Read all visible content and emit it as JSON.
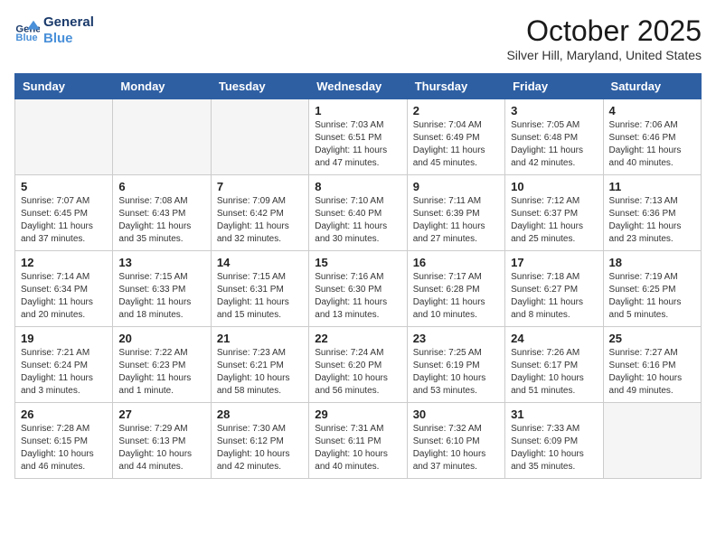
{
  "header": {
    "logo_line1": "General",
    "logo_line2": "Blue",
    "month_title": "October 2025",
    "location": "Silver Hill, Maryland, United States"
  },
  "weekdays": [
    "Sunday",
    "Monday",
    "Tuesday",
    "Wednesday",
    "Thursday",
    "Friday",
    "Saturday"
  ],
  "weeks": [
    [
      {
        "day": "",
        "info": ""
      },
      {
        "day": "",
        "info": ""
      },
      {
        "day": "",
        "info": ""
      },
      {
        "day": "1",
        "info": "Sunrise: 7:03 AM\nSunset: 6:51 PM\nDaylight: 11 hours\nand 47 minutes."
      },
      {
        "day": "2",
        "info": "Sunrise: 7:04 AM\nSunset: 6:49 PM\nDaylight: 11 hours\nand 45 minutes."
      },
      {
        "day": "3",
        "info": "Sunrise: 7:05 AM\nSunset: 6:48 PM\nDaylight: 11 hours\nand 42 minutes."
      },
      {
        "day": "4",
        "info": "Sunrise: 7:06 AM\nSunset: 6:46 PM\nDaylight: 11 hours\nand 40 minutes."
      }
    ],
    [
      {
        "day": "5",
        "info": "Sunrise: 7:07 AM\nSunset: 6:45 PM\nDaylight: 11 hours\nand 37 minutes."
      },
      {
        "day": "6",
        "info": "Sunrise: 7:08 AM\nSunset: 6:43 PM\nDaylight: 11 hours\nand 35 minutes."
      },
      {
        "day": "7",
        "info": "Sunrise: 7:09 AM\nSunset: 6:42 PM\nDaylight: 11 hours\nand 32 minutes."
      },
      {
        "day": "8",
        "info": "Sunrise: 7:10 AM\nSunset: 6:40 PM\nDaylight: 11 hours\nand 30 minutes."
      },
      {
        "day": "9",
        "info": "Sunrise: 7:11 AM\nSunset: 6:39 PM\nDaylight: 11 hours\nand 27 minutes."
      },
      {
        "day": "10",
        "info": "Sunrise: 7:12 AM\nSunset: 6:37 PM\nDaylight: 11 hours\nand 25 minutes."
      },
      {
        "day": "11",
        "info": "Sunrise: 7:13 AM\nSunset: 6:36 PM\nDaylight: 11 hours\nand 23 minutes."
      }
    ],
    [
      {
        "day": "12",
        "info": "Sunrise: 7:14 AM\nSunset: 6:34 PM\nDaylight: 11 hours\nand 20 minutes."
      },
      {
        "day": "13",
        "info": "Sunrise: 7:15 AM\nSunset: 6:33 PM\nDaylight: 11 hours\nand 18 minutes."
      },
      {
        "day": "14",
        "info": "Sunrise: 7:15 AM\nSunset: 6:31 PM\nDaylight: 11 hours\nand 15 minutes."
      },
      {
        "day": "15",
        "info": "Sunrise: 7:16 AM\nSunset: 6:30 PM\nDaylight: 11 hours\nand 13 minutes."
      },
      {
        "day": "16",
        "info": "Sunrise: 7:17 AM\nSunset: 6:28 PM\nDaylight: 11 hours\nand 10 minutes."
      },
      {
        "day": "17",
        "info": "Sunrise: 7:18 AM\nSunset: 6:27 PM\nDaylight: 11 hours\nand 8 minutes."
      },
      {
        "day": "18",
        "info": "Sunrise: 7:19 AM\nSunset: 6:25 PM\nDaylight: 11 hours\nand 5 minutes."
      }
    ],
    [
      {
        "day": "19",
        "info": "Sunrise: 7:21 AM\nSunset: 6:24 PM\nDaylight: 11 hours\nand 3 minutes."
      },
      {
        "day": "20",
        "info": "Sunrise: 7:22 AM\nSunset: 6:23 PM\nDaylight: 11 hours\nand 1 minute."
      },
      {
        "day": "21",
        "info": "Sunrise: 7:23 AM\nSunset: 6:21 PM\nDaylight: 10 hours\nand 58 minutes."
      },
      {
        "day": "22",
        "info": "Sunrise: 7:24 AM\nSunset: 6:20 PM\nDaylight: 10 hours\nand 56 minutes."
      },
      {
        "day": "23",
        "info": "Sunrise: 7:25 AM\nSunset: 6:19 PM\nDaylight: 10 hours\nand 53 minutes."
      },
      {
        "day": "24",
        "info": "Sunrise: 7:26 AM\nSunset: 6:17 PM\nDaylight: 10 hours\nand 51 minutes."
      },
      {
        "day": "25",
        "info": "Sunrise: 7:27 AM\nSunset: 6:16 PM\nDaylight: 10 hours\nand 49 minutes."
      }
    ],
    [
      {
        "day": "26",
        "info": "Sunrise: 7:28 AM\nSunset: 6:15 PM\nDaylight: 10 hours\nand 46 minutes."
      },
      {
        "day": "27",
        "info": "Sunrise: 7:29 AM\nSunset: 6:13 PM\nDaylight: 10 hours\nand 44 minutes."
      },
      {
        "day": "28",
        "info": "Sunrise: 7:30 AM\nSunset: 6:12 PM\nDaylight: 10 hours\nand 42 minutes."
      },
      {
        "day": "29",
        "info": "Sunrise: 7:31 AM\nSunset: 6:11 PM\nDaylight: 10 hours\nand 40 minutes."
      },
      {
        "day": "30",
        "info": "Sunrise: 7:32 AM\nSunset: 6:10 PM\nDaylight: 10 hours\nand 37 minutes."
      },
      {
        "day": "31",
        "info": "Sunrise: 7:33 AM\nSunset: 6:09 PM\nDaylight: 10 hours\nand 35 minutes."
      },
      {
        "day": "",
        "info": ""
      }
    ]
  ]
}
